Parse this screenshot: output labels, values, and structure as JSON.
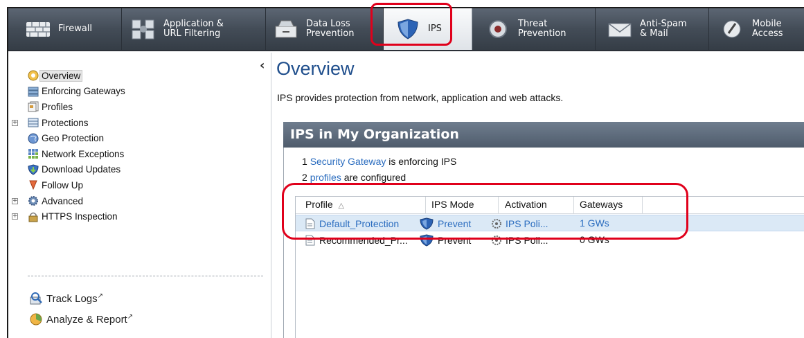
{
  "tabs": [
    {
      "id": "firewall",
      "label": "Firewall",
      "icon": "firewall-icon",
      "active": false
    },
    {
      "id": "app-url",
      "label": "Application &\nURL Filtering",
      "icon": "application-cubes-icon",
      "active": false
    },
    {
      "id": "dlp",
      "label": "Data Loss\nPrevention",
      "icon": "data-loss-prevention-icon",
      "active": false
    },
    {
      "id": "ips",
      "label": "IPS",
      "icon": "shield-icon",
      "active": true
    },
    {
      "id": "threat",
      "label": "Threat\nPrevention",
      "icon": "threat-prevention-icon",
      "active": false
    },
    {
      "id": "antispam",
      "label": "Anti-Spam\n& Mail",
      "icon": "envelope-icon",
      "active": false
    },
    {
      "id": "mobile",
      "label": "Mobile\nAccess",
      "icon": "mobile-access-icon",
      "active": false
    }
  ],
  "sidebar": {
    "collapse_glyph": "‹",
    "items": [
      {
        "label": "Overview",
        "icon": "overview-icon",
        "expandable": false,
        "selected": true
      },
      {
        "label": "Enforcing Gateways",
        "icon": "gateways-icon",
        "expandable": false,
        "selected": false
      },
      {
        "label": "Profiles",
        "icon": "profiles-icon",
        "expandable": false,
        "selected": false
      },
      {
        "label": "Protections",
        "icon": "protections-icon",
        "expandable": true,
        "selected": false
      },
      {
        "label": "Geo Protection",
        "icon": "geo-protection-icon",
        "expandable": false,
        "selected": false
      },
      {
        "label": "Network Exceptions",
        "icon": "network-exceptions-icon",
        "expandable": false,
        "selected": false
      },
      {
        "label": "Download Updates",
        "icon": "download-updates-icon",
        "expandable": false,
        "selected": false
      },
      {
        "label": "Follow Up",
        "icon": "follow-up-icon",
        "expandable": false,
        "selected": false
      },
      {
        "label": "Advanced",
        "icon": "advanced-gear-icon",
        "expandable": true,
        "selected": false
      },
      {
        "label": "HTTPS Inspection",
        "icon": "https-lock-icon",
        "expandable": true,
        "selected": false
      }
    ],
    "bottom_links": [
      {
        "label": "Track Logs",
        "icon": "track-logs-icon"
      },
      {
        "label": "Analyze & Report",
        "icon": "analyze-report-icon"
      }
    ]
  },
  "main": {
    "title": "Overview",
    "description": "IPS provides protection from network, application and web attacks.",
    "org_header": "IPS in My Organization",
    "gateway_count": "1",
    "gateway_link": "Security Gateway",
    "gateway_suffix": "is enforcing IPS",
    "profile_count": "2",
    "profile_link": "profiles",
    "profile_suffix": "are configured",
    "table": {
      "columns": [
        "Profile",
        "IPS Mode",
        "Activation",
        "Gateways"
      ],
      "sort_glyph": "△",
      "rows": [
        {
          "profile": "Default_Protection",
          "mode": "Prevent",
          "activation": "IPS Poli...",
          "gateways": "1 GWs",
          "selected": true
        },
        {
          "profile": "Recommended_Pr...",
          "mode": "Prevent",
          "activation": "IPS Poli...",
          "gateways": "0 GWs",
          "selected": false
        }
      ]
    }
  },
  "colors": {
    "highlight_outline": "#e0001b",
    "title_blue": "#1f4e8c",
    "link_blue": "#2a6cbf"
  }
}
